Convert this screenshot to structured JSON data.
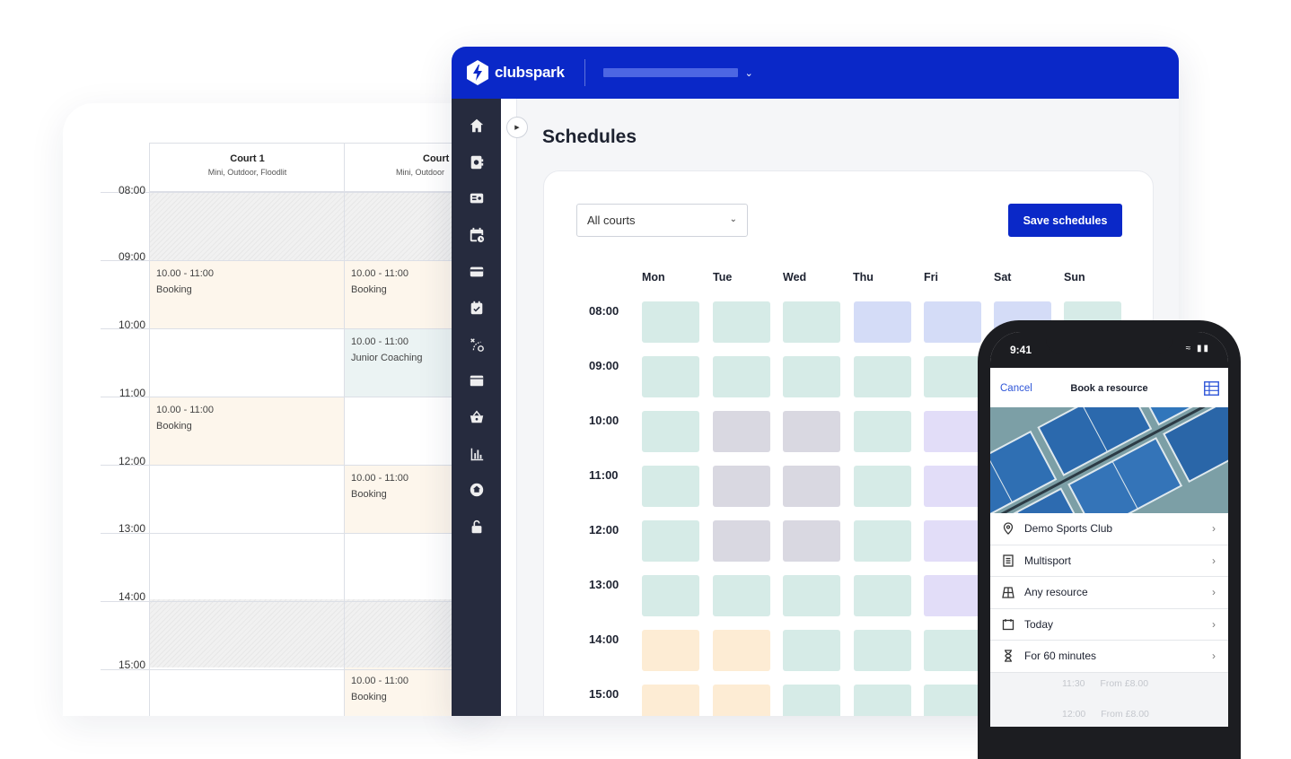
{
  "calendar": {
    "courts": [
      {
        "name": "Court 1",
        "sub": "Mini, Outdoor, Floodlit"
      },
      {
        "name": "Court",
        "sub": "Mini, Outdoor"
      }
    ],
    "times": [
      "08:00",
      "09:00",
      "10:00",
      "11:00",
      "12:00",
      "13:00",
      "14:00",
      "15:00"
    ],
    "slots": [
      {
        "time": "10.00 - 11:00",
        "label": "Booking"
      },
      {
        "time": "10.00 - 11:00",
        "label": "Booking"
      },
      {
        "time": "10.00 - 11:00",
        "label": "Junior Coaching"
      },
      {
        "time": "10.00 - 11:00",
        "label": "Booking"
      },
      {
        "time": "10.00 - 11:00",
        "label": "Booking"
      },
      {
        "time": "10.00 - 11:00",
        "label": "Booking"
      }
    ]
  },
  "app": {
    "brand": "clubspark",
    "brand_color": "#0a28c8",
    "nav_icons": [
      "home-icon",
      "bookings-icon",
      "membership-card-icon",
      "schedules-icon",
      "payments-icon",
      "events-icon",
      "coaching-icon",
      "video-icon",
      "shop-icon",
      "reports-icon",
      "venue-icon",
      "access-icon"
    ],
    "page_title": "Schedules",
    "court_filter": "All courts",
    "save_label": "Save schedules",
    "days": [
      "Mon",
      "Tue",
      "Wed",
      "Thu",
      "Fri",
      "Sat",
      "Sun"
    ],
    "hours": [
      "08:00",
      "09:00",
      "10:00",
      "11:00",
      "12:00",
      "13:00",
      "14:00",
      "15:00"
    ],
    "colors": {
      "open": "#d6ebe7",
      "blue": "#d4dcf7",
      "closed": "#d9d8e1",
      "purple": "#e2ddf8",
      "peak": "#fdecd4"
    }
  },
  "phone": {
    "time": "9:41",
    "cancel": "Cancel",
    "title": "Book a resource",
    "items": [
      {
        "icon": "location-pin-icon",
        "label": "Demo Sports Club"
      },
      {
        "icon": "document-icon",
        "label": "Multisport"
      },
      {
        "icon": "court-icon",
        "label": "Any resource"
      },
      {
        "icon": "calendar-icon",
        "label": "Today"
      },
      {
        "icon": "hourglass-icon",
        "label": "For 60 minutes"
      }
    ],
    "times": [
      {
        "time": "11:30",
        "price": "From £8.00"
      },
      {
        "time": "12:00",
        "price": "From £8.00"
      }
    ]
  }
}
